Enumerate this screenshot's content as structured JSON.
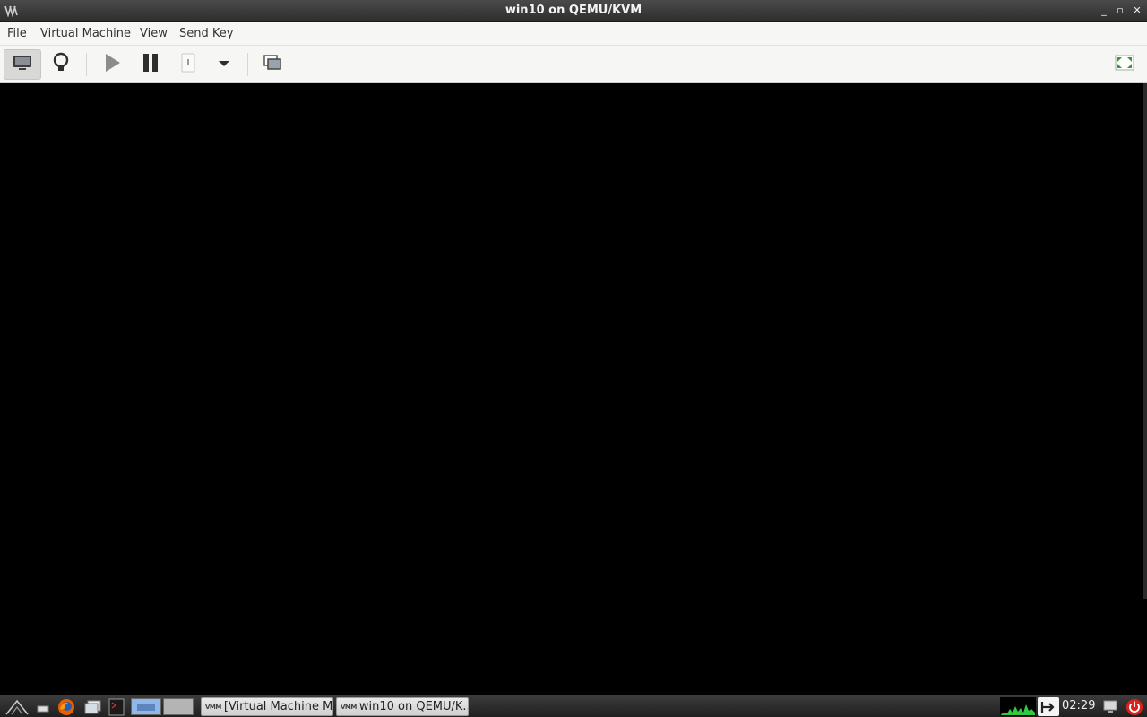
{
  "window": {
    "title": "win10 on QEMU/KVM",
    "icon": "virt-manager-icon",
    "controls": [
      "minimize-icon",
      "maximize-icon",
      "close-icon"
    ],
    "minimize_glyph": "_",
    "maximize_glyph": "▫",
    "close_glyph": "✕"
  },
  "menubar": {
    "file": "File",
    "virtual_machine": "Virtual Machine",
    "view": "View",
    "send_key": "Send Key"
  },
  "toolbar": {
    "buttons": [
      {
        "name": "show-console",
        "icon": "monitor-icon",
        "active": true
      },
      {
        "name": "show-details",
        "icon": "lightbulb-icon",
        "active": false
      },
      {
        "name": "run",
        "icon": "play-icon",
        "active": false
      },
      {
        "name": "pause",
        "icon": "pause-icon",
        "active": false
      },
      {
        "name": "shutdown",
        "icon": "power-switch-icon",
        "active": false
      },
      {
        "name": "shutdown-menu",
        "icon": "dropdown-arrow-icon",
        "active": false
      },
      {
        "name": "snapshots",
        "icon": "snapshots-icon",
        "active": false
      },
      {
        "name": "fullscreen",
        "icon": "fullscreen-icon",
        "active": false
      }
    ]
  },
  "taskbar": {
    "tasks": [
      {
        "label": "[Virtual Machine M...",
        "icon": "virt-manager-icon"
      },
      {
        "label": "win10 on QEMU/K...",
        "icon": "virt-manager-icon"
      }
    ],
    "task_icon_text": "VMM",
    "clock": "02:29"
  },
  "colors": {
    "console_bg": "#000000",
    "titlebar_bg": "#3a3a3a",
    "menubar_bg": "#f6f6f5",
    "power_red": "#d9241e",
    "netmon_green": "#2ecc40"
  }
}
